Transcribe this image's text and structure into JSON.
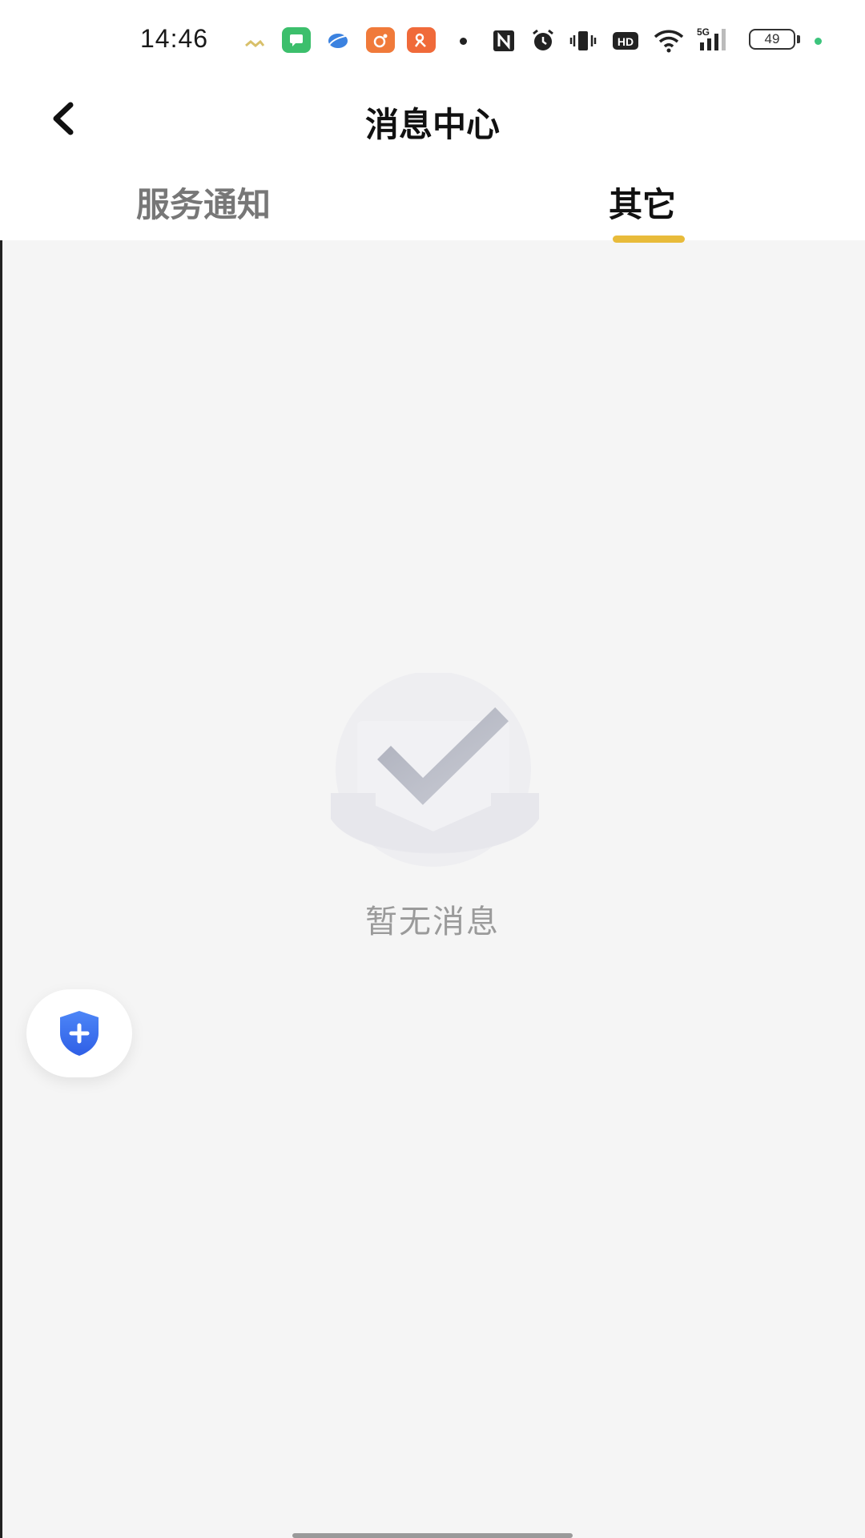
{
  "status_bar": {
    "time": "14:46",
    "battery_level": "49",
    "icons": [
      "notification-icon",
      "message-app-icon",
      "browser-app-icon",
      "weibo-app-icon",
      "weibo-alt-app-icon",
      "dot-icon",
      "nfc-icon",
      "alarm-icon",
      "vibrate-icon",
      "hd-icon",
      "wifi-icon",
      "signal-5g-icon",
      "battery-icon"
    ]
  },
  "header": {
    "title": "消息中心",
    "back_icon": "chevron-left-icon"
  },
  "tabs": [
    {
      "label": "服务通知",
      "active": false
    },
    {
      "label": "其它",
      "active": true
    }
  ],
  "colors": {
    "tab_indicator": "#e8bb3a",
    "background": "#f5f5f5",
    "shield": "#3a6ef2"
  },
  "empty_state": {
    "icon": "empty-inbox-check-icon",
    "text": "暂无消息"
  },
  "floating_button": {
    "icon": "shield-plus-icon"
  }
}
